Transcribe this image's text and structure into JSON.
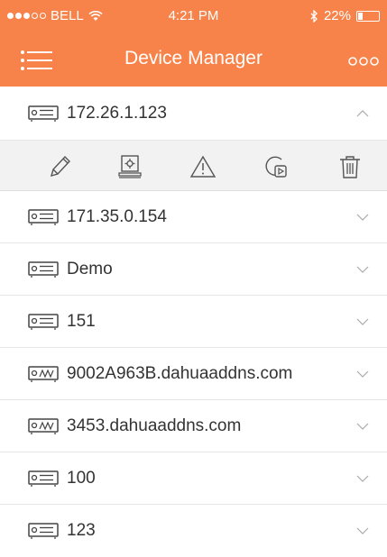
{
  "status_bar": {
    "carrier": "BELL",
    "time": "4:21 PM",
    "battery_text": "22%",
    "battery_level": 0.22,
    "signal_bars_filled": 3,
    "signal_bars_total": 5
  },
  "nav": {
    "title": "Device Manager",
    "menu_icon": "hamburger-menu-icon",
    "more_icon": "more-options-icon"
  },
  "colors": {
    "accent": "#f7834a",
    "divider": "#e6e6e6",
    "action_bar_bg": "#f2f2f2",
    "text": "#333333"
  },
  "devices": [
    {
      "label": "172.26.1.123",
      "icon": "dvr-device-icon",
      "expanded": true
    },
    {
      "label": "171.35.0.154",
      "icon": "dvr-device-icon",
      "expanded": false
    },
    {
      "label": "Demo",
      "icon": "dvr-device-icon",
      "expanded": false
    },
    {
      "label": "151",
      "icon": "dvr-device-icon",
      "expanded": false
    },
    {
      "label": "9002A963B.dahuaaddns.com",
      "icon": "ddns-device-icon",
      "expanded": false
    },
    {
      "label": "3453.dahuaaddns.com",
      "icon": "ddns-device-icon",
      "expanded": false
    },
    {
      "label": "100",
      "icon": "dvr-device-icon",
      "expanded": false
    },
    {
      "label": "123",
      "icon": "dvr-device-icon",
      "expanded": false
    }
  ],
  "actions": [
    "edit-icon",
    "remote-config-icon",
    "alarm-warning-icon",
    "playback-icon",
    "delete-icon"
  ]
}
